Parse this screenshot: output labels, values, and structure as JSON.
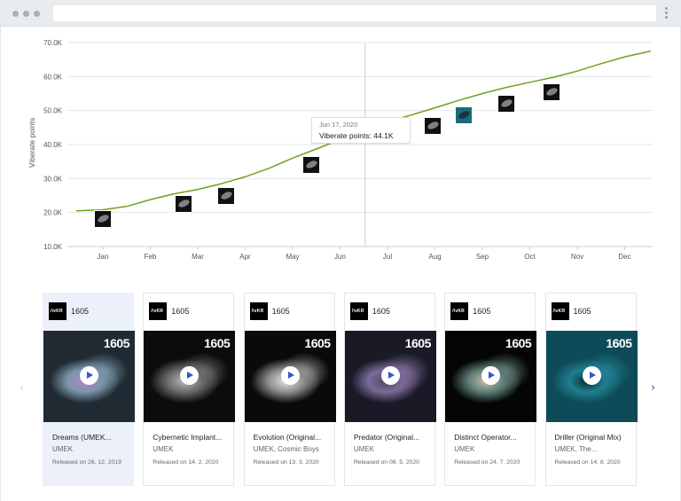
{
  "browser": {
    "title": ""
  },
  "chart_data": {
    "type": "line",
    "ylabel": "Viberate points",
    "y_ticks": [
      "10.0K",
      "20.0K",
      "30.0K",
      "40.0K",
      "50.0K",
      "60.0K",
      "70.0K"
    ],
    "ylim": [
      10000,
      70000
    ],
    "x_ticks": [
      "Jan",
      "Feb",
      "Mar",
      "Apr",
      "May",
      "Jun",
      "Jul",
      "Aug",
      "Sep",
      "Oct",
      "Nov",
      "Dec"
    ],
    "grid": true,
    "series": [
      {
        "color": "#6fa21c",
        "x": [
          -0.6,
          0.0,
          0.5,
          1.0,
          1.5,
          2.0,
          2.5,
          3.0,
          3.5,
          4.0,
          4.5,
          5.0,
          5.5,
          6.0,
          6.5,
          7.0,
          7.5,
          8.0,
          8.5,
          9.0,
          9.5,
          10.0,
          10.5,
          11.0,
          11.55
        ],
        "values": [
          20500,
          20800,
          21800,
          23800,
          25500,
          26800,
          28500,
          30500,
          33000,
          36000,
          38700,
          41500,
          44300,
          46700,
          48700,
          50800,
          53000,
          55000,
          56800,
          58300,
          59800,
          61600,
          63800,
          65800,
          67500
        ]
      }
    ]
  },
  "tooltip": {
    "date": "Jun 17, 2020",
    "label": "Viberate points: 44.1K"
  },
  "release_markers": [
    {
      "x": 0.0,
      "y": 18000,
      "style": "dark"
    },
    {
      "x": 1.7,
      "y": 22500,
      "style": "dark"
    },
    {
      "x": 2.6,
      "y": 25000,
      "style": "dark"
    },
    {
      "x": 4.4,
      "y": 34000,
      "style": "dark"
    },
    {
      "x": 6.95,
      "y": 45500,
      "style": "dark"
    },
    {
      "x": 7.6,
      "y": 48500,
      "style": "teal"
    },
    {
      "x": 8.5,
      "y": 52000,
      "style": "dark"
    },
    {
      "x": 9.45,
      "y": 55500,
      "style": "dark"
    }
  ],
  "cards": [
    {
      "artist_code": "1605",
      "logo_text": "/\\vKR",
      "art_label": "1605",
      "title": "Dreams (UMEK...",
      "artists": "UMEK",
      "released": "Released on 26. 12. 2019",
      "art_colors": [
        "#1f2a33",
        "#7a96a8",
        "#b57fd0"
      ]
    },
    {
      "artist_code": "1605",
      "logo_text": "/\\vKR",
      "art_label": "1605",
      "title": "Cybernetic Implant...",
      "artists": "UMEK",
      "released": "Released on 14. 2. 2020",
      "art_colors": [
        "#0c0c0c",
        "#6b6b6b",
        "#bcbcbc"
      ]
    },
    {
      "artist_code": "1605",
      "logo_text": "/\\vKR",
      "art_label": "1605",
      "title": "Evolution (Original...",
      "artists": "UMEK, Cosmic Boys",
      "released": "Released on 13. 3. 2020",
      "art_colors": [
        "#0a0a0a",
        "#8d8d8d",
        "#e6e6e6"
      ]
    },
    {
      "artist_code": "1605",
      "logo_text": "/\\vKR",
      "art_label": "1605",
      "title": "Predator (Original...",
      "artists": "UMEK",
      "released": "Released on 08. 5. 2020",
      "art_colors": [
        "#1a1a26",
        "#7b6a99",
        "#4a4a5c"
      ]
    },
    {
      "artist_code": "1605",
      "logo_text": "/\\vKR",
      "art_label": "1605",
      "title": "Distinct Operator...",
      "artists": "UMEK",
      "released": "Released on 24. 7. 2020",
      "art_colors": [
        "#050505",
        "#5e7e78",
        "#c9c0a6"
      ]
    },
    {
      "artist_code": "1605",
      "logo_text": "/\\vKR",
      "art_label": "1605",
      "title": "Driller (Original Mix)",
      "artists": "UMEK, The...",
      "released": "Released on 14. 8. 2020",
      "art_colors": [
        "#0e4b58",
        "#1f7f8f",
        "#06262e"
      ]
    }
  ],
  "nav": {
    "prev": "‹",
    "next": "›"
  }
}
